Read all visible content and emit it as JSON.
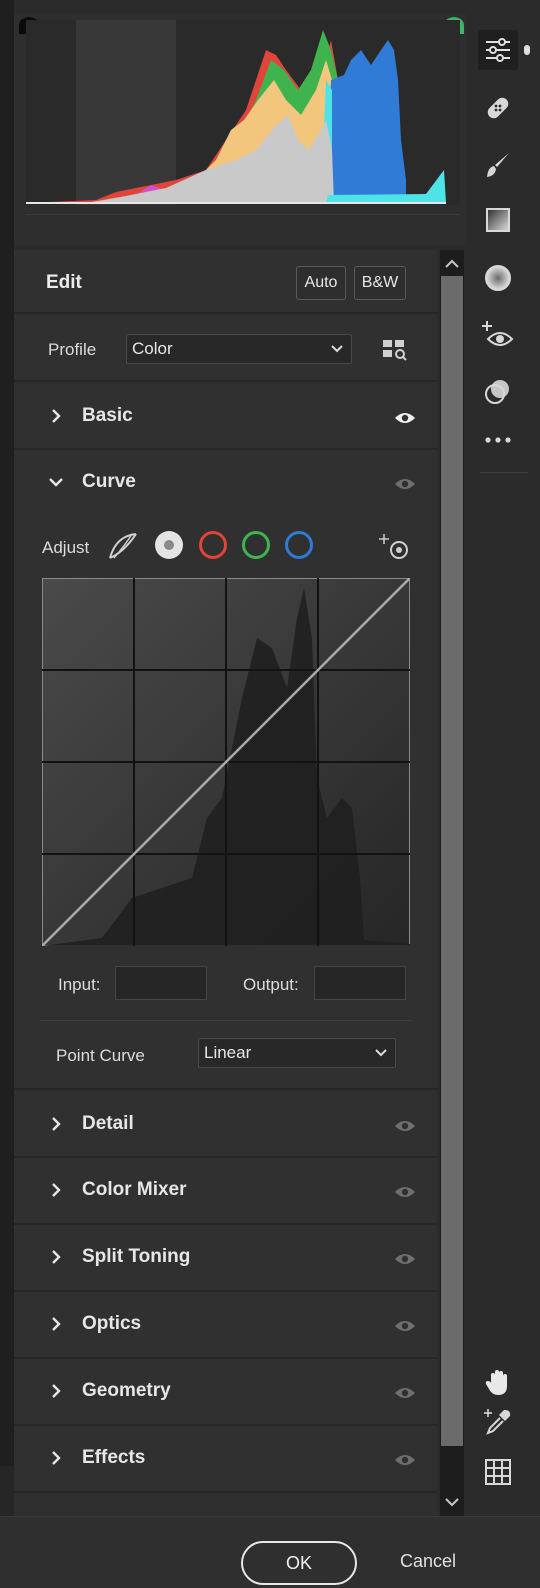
{
  "panel": {
    "edit": {
      "title": "Edit",
      "auto_label": "Auto",
      "bw_label": "B&W"
    },
    "profile": {
      "label": "Profile",
      "value": "Color"
    },
    "sections": {
      "basic": "Basic",
      "curve": "Curve",
      "detail": "Detail",
      "color_mixer": "Color Mixer",
      "split_toning": "Split Toning",
      "optics": "Optics",
      "geometry": "Geometry",
      "effects": "Effects"
    },
    "curve": {
      "adjust_label": "Adjust",
      "input_label": "Input:",
      "output_label": "Output:",
      "input_value": "",
      "output_value": "",
      "point_curve_label": "Point Curve",
      "point_curve_value": "Linear"
    }
  },
  "footer": {
    "ok_label": "OK",
    "cancel_label": "Cancel"
  },
  "toolbar": {
    "icons": [
      "edit-sliders-icon",
      "spot-removal-icon",
      "brush-icon",
      "gradient-icon",
      "radial-filter-icon",
      "red-eye-icon",
      "presets-icon",
      "more-icon",
      "hand-icon",
      "color-sampler-icon",
      "grid-icon"
    ]
  },
  "colors": {
    "red": "#e0443a",
    "green": "#3fb44e",
    "blue": "#2f7bd6",
    "yellow": "#f3c67e",
    "cyan": "#4ee3e6",
    "magenta": "#d54fc9",
    "luminance": "#c9c9c9"
  }
}
